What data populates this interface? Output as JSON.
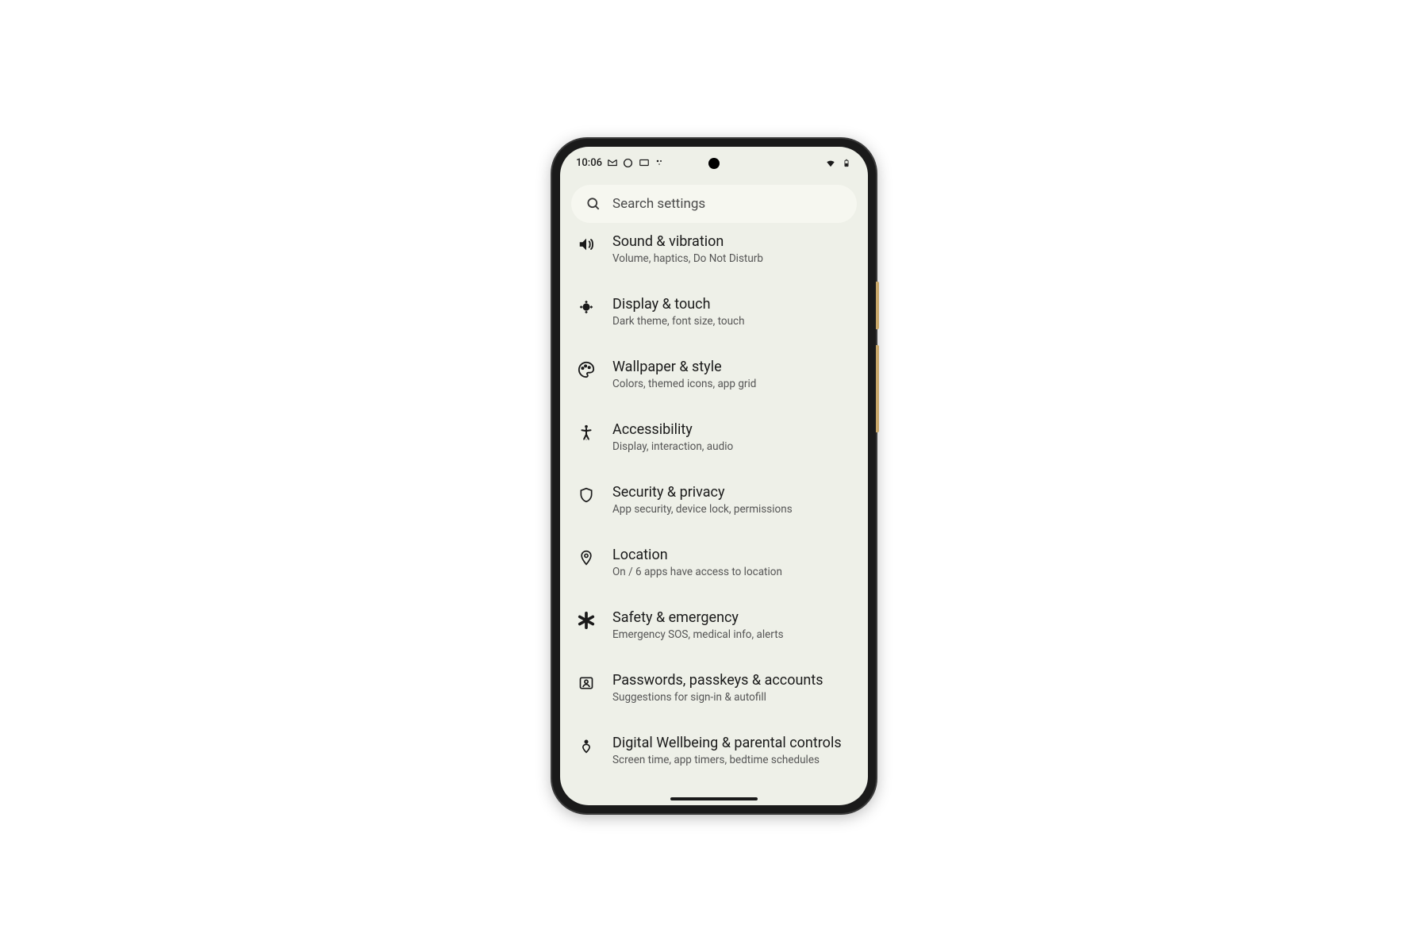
{
  "status_bar": {
    "time": "10:06"
  },
  "search": {
    "placeholder": "Search settings"
  },
  "settings": [
    {
      "icon": "volume",
      "title": "Sound & vibration",
      "subtitle": "Volume, haptics, Do Not Disturb"
    },
    {
      "icon": "brightness",
      "title": "Display & touch",
      "subtitle": "Dark theme, font size, touch"
    },
    {
      "icon": "palette",
      "title": "Wallpaper & style",
      "subtitle": "Colors, themed icons, app grid"
    },
    {
      "icon": "accessibility",
      "title": "Accessibility",
      "subtitle": "Display, interaction, audio"
    },
    {
      "icon": "shield",
      "title": "Security & privacy",
      "subtitle": "App security, device lock, permissions"
    },
    {
      "icon": "location",
      "title": "Location",
      "subtitle": "On / 6 apps have access to location"
    },
    {
      "icon": "asterisk",
      "title": "Safety & emergency",
      "subtitle": "Emergency SOS, medical info, alerts"
    },
    {
      "icon": "account",
      "title": "Passwords, passkeys & accounts",
      "subtitle": "Suggestions for sign-in & autofill"
    },
    {
      "icon": "wellbeing",
      "title": "Digital Wellbeing & parental controls",
      "subtitle": "Screen time, app timers, bedtime schedules"
    }
  ]
}
